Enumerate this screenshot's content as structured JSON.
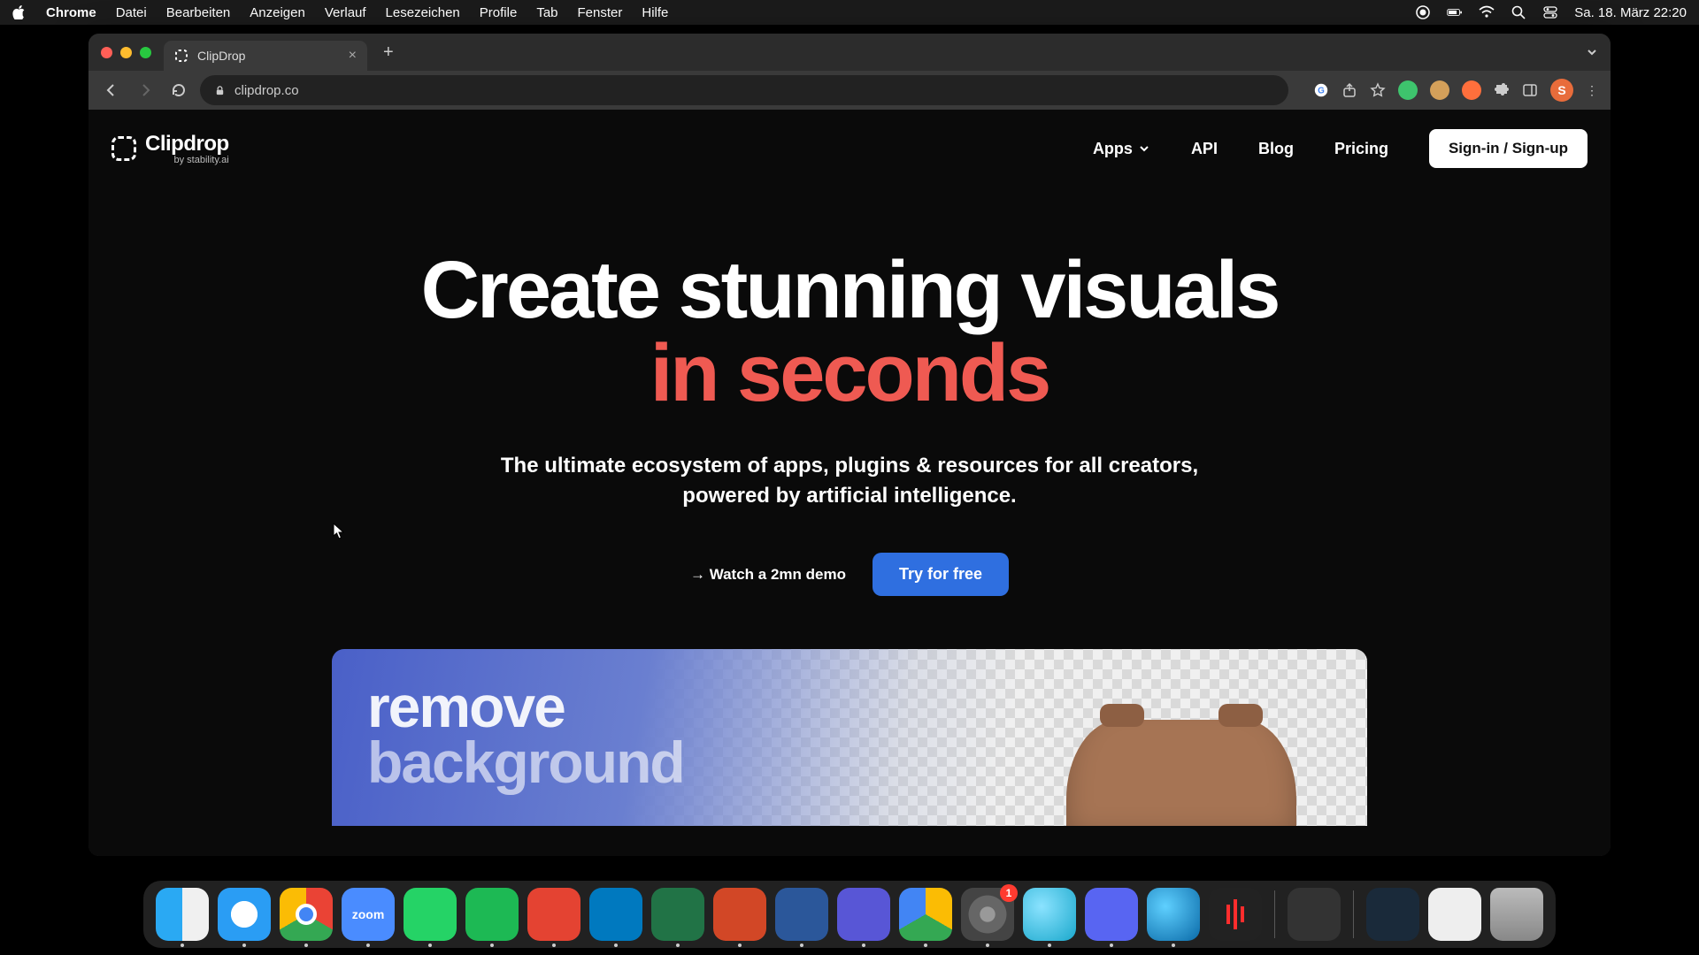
{
  "menubar": {
    "app": "Chrome",
    "items": [
      "Datei",
      "Bearbeiten",
      "Anzeigen",
      "Verlauf",
      "Lesezeichen",
      "Profile",
      "Tab",
      "Fenster",
      "Hilfe"
    ],
    "datetime": "Sa. 18. März  22:20"
  },
  "browser": {
    "tab_title": "ClipDrop",
    "url": "clipdrop.co",
    "avatar_initial": "S"
  },
  "site": {
    "brand": "Clipdrop",
    "brand_sub": "by stability.ai",
    "nav": {
      "apps": "Apps",
      "api": "API",
      "blog": "Blog",
      "pricing": "Pricing"
    },
    "signin": "Sign-in / Sign-up",
    "hero": {
      "line1": "Create stunning visuals",
      "line2": "in seconds",
      "subtitle1": "The ultimate ecosystem of apps, plugins & resources for all creators,",
      "subtitle2": "powered by artificial intelligence.",
      "demo_link": "→ Watch a 2mn demo",
      "cta": "Try for free"
    },
    "feature": {
      "word1": "remove",
      "word2": "background"
    }
  },
  "dock": {
    "settings_badge": "1",
    "zoom_label": "zoom"
  }
}
